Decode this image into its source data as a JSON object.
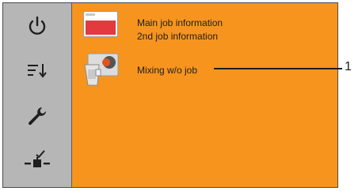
{
  "colors": {
    "accent": "#f7941e",
    "sidebar": "#b6b6b6",
    "icon": "#1e1e1e"
  },
  "sidebar": {
    "items": [
      {
        "icon": "power-icon"
      },
      {
        "icon": "sort-list-icon"
      },
      {
        "icon": "wrench-icon"
      },
      {
        "icon": "checked-valve-icon"
      }
    ]
  },
  "main": {
    "job_info": {
      "line1": "Main job information",
      "line2": "2nd job information",
      "icon": "job-card-icon"
    },
    "mixing": {
      "label": "Mixing w/o job",
      "icon": "mixing-containers-icon"
    }
  },
  "callout": {
    "number": "1"
  }
}
